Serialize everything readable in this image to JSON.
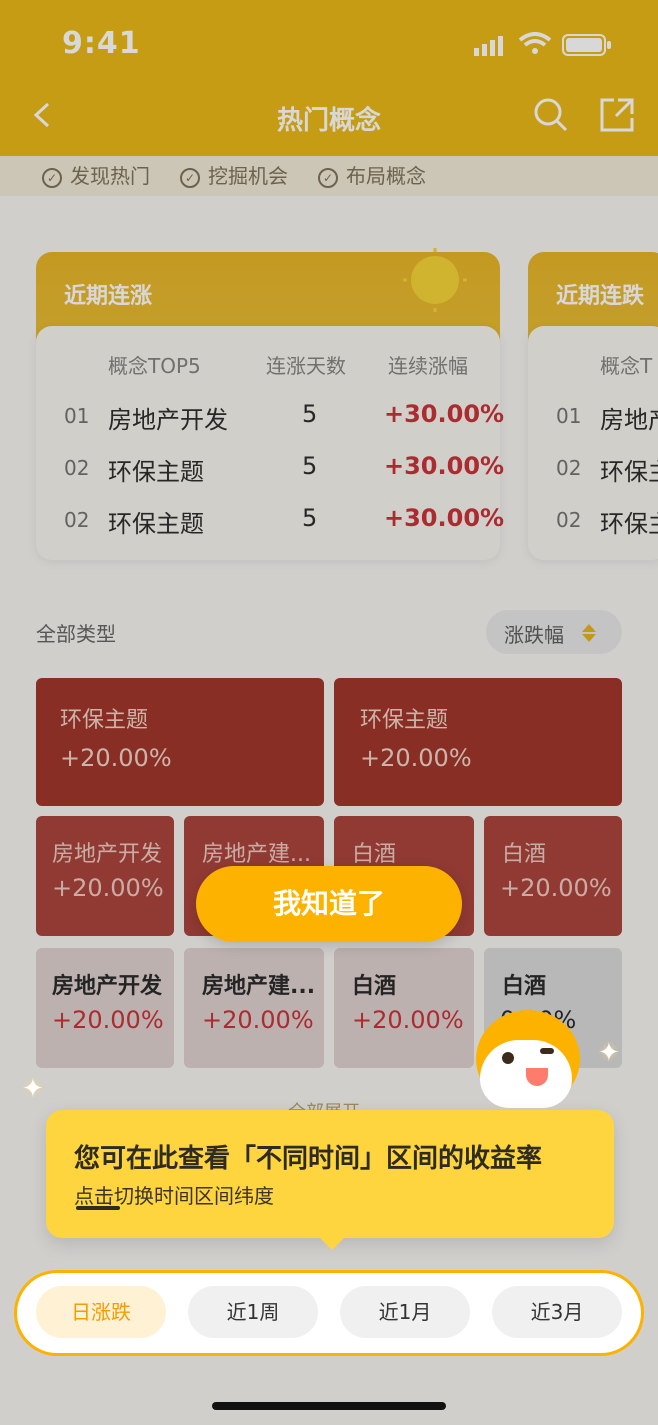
{
  "status": {
    "time": "9:41"
  },
  "nav": {
    "title": "热门概念",
    "back": "<"
  },
  "tags": [
    "发现热门",
    "挖掘机会",
    "布局概念"
  ],
  "cards": [
    {
      "title": "近期连涨",
      "headers": [
        "概念TOP5",
        "连涨天数",
        "连续涨幅"
      ],
      "rows": [
        {
          "idx": "01",
          "name": "房地产开发",
          "days": "5",
          "pct": "+30.00%"
        },
        {
          "idx": "02",
          "name": "环保主题",
          "days": "5",
          "pct": "+30.00%"
        },
        {
          "idx": "02",
          "name": "环保主题",
          "days": "5",
          "pct": "+30.00%"
        }
      ]
    },
    {
      "title": "近期连跌",
      "headers": [
        "概念T"
      ],
      "rows": [
        {
          "idx": "01",
          "name": "房地产"
        },
        {
          "idx": "02",
          "name": "环保主"
        },
        {
          "idx": "02",
          "name": "环保主"
        }
      ]
    }
  ],
  "section": {
    "label": "全部类型",
    "sort": "涨跌幅"
  },
  "tiles_big": [
    {
      "name": "环保主题",
      "val": "+20.00%"
    },
    {
      "name": "环保主题",
      "val": "+20.00%"
    }
  ],
  "tiles_mid": [
    {
      "name": "房地产开发",
      "val": "+20.00%"
    },
    {
      "name": "房地产建...",
      "val": ""
    },
    {
      "name": "白酒",
      "val": ""
    },
    {
      "name": "白酒",
      "val": "+20.00%"
    }
  ],
  "tiles_low": [
    {
      "name": "房地产开发",
      "val": "+20.00%"
    },
    {
      "name": "房地产建...",
      "val": "+20.00%"
    },
    {
      "name": "白酒",
      "val": "+20.00%"
    },
    {
      "name": "白酒",
      "val": "0.00%"
    }
  ],
  "expand": "全部展开",
  "cta": "我知道了",
  "tooltip": {
    "title": "您可在此查看「不同时间」区间的收益率",
    "sub": "点击切换时间区间纬度"
  },
  "periods": [
    "日涨跌",
    "近1周",
    "近1月",
    "近3月"
  ],
  "colors": {
    "brand": "#fdb200",
    "up": "#c7272e",
    "tile_deep": "#9b2b1f"
  }
}
